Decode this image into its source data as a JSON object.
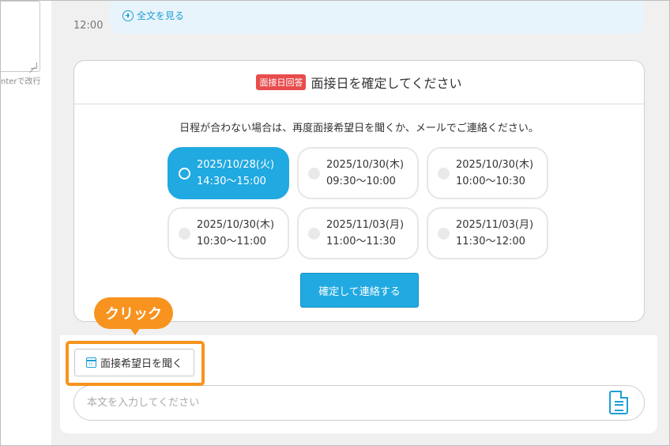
{
  "left_pane": {
    "hint_text": "nterで改行"
  },
  "timeline": {
    "time": "12:00",
    "view_all_label": "全文を見る"
  },
  "interview_card": {
    "badge": "面接日回答",
    "title": "面接日を確定してください",
    "note": "日程が合わない場合は、再度面接希望日を聞くか、メールでご連絡ください。",
    "slots": [
      {
        "date": "2025/10/28(火)",
        "time": "14:30〜15:00",
        "selected": true
      },
      {
        "date": "2025/10/30(木)",
        "time": "09:30〜10:00",
        "selected": false
      },
      {
        "date": "2025/10/30(木)",
        "time": "10:00〜10:30",
        "selected": false
      },
      {
        "date": "2025/10/30(木)",
        "time": "10:30〜11:00",
        "selected": false
      },
      {
        "date": "2025/11/03(月)",
        "time": "11:00〜11:30",
        "selected": false
      },
      {
        "date": "2025/11/03(月)",
        "time": "11:30〜12:00",
        "selected": false
      }
    ],
    "confirm_label": "確定して連絡する"
  },
  "composer": {
    "callout": "クリック",
    "ask_button_label": "面接希望日を聞く",
    "input_placeholder": "本文を入力してください",
    "input_value": ""
  },
  "colors": {
    "accent": "#21a9e1",
    "badge": "#e84c4c",
    "highlight": "#f7931e"
  },
  "icons": {
    "view_all": "plus-circle-icon",
    "ask_button": "calendar-icon",
    "template": "document-icon"
  }
}
